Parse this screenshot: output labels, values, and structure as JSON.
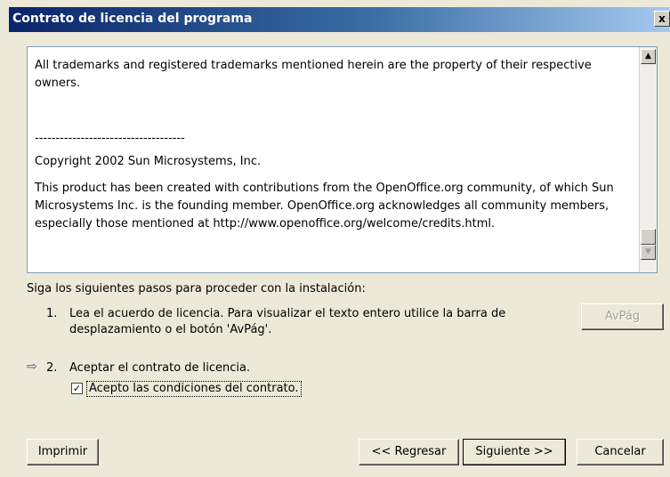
{
  "window": {
    "title": "Contrato de licencia del programa",
    "close_glyph": "x"
  },
  "license": {
    "dashes_top": "------------------------------------------------------------------------------------------------------",
    "trademark": "All trademarks and registered trademarks mentioned herein are the property of their respective owners.",
    "dashes_mid": "------------------------------------",
    "copyright": "Copyright 2002 Sun Microsystems, Inc.",
    "contrib": "This product has been created with contributions from the OpenOffice.org community, of which Sun Microsystems Inc. is the founding member. OpenOffice.org acknowledges all community members, especially those mentioned at http://www.openoffice.org/welcome/credits.html."
  },
  "instructions": {
    "heading": "Siga los siguientes pasos para proceder con la instalación:",
    "step1_number": "1.",
    "step1_text": "Lea el acuerdo de licencia. Para visualizar el texto entero utilice la barra de desplazamiento o el botón 'AvPág'.",
    "step2_number": "2.",
    "step2_text": "Aceptar el contrato de licencia.",
    "checkbox_label": "Acepto las condiciones del contrato.",
    "checkbox_checked": true,
    "checkmark": "✓"
  },
  "buttons": {
    "pagedown": "AvPág",
    "print": "Imprimir",
    "back": "<< Regresar",
    "next": "Siguiente >>",
    "cancel": "Cancelar"
  },
  "icons": {
    "scroll_up": "▲",
    "scroll_down": "▼",
    "step_arrow": "⇨"
  }
}
